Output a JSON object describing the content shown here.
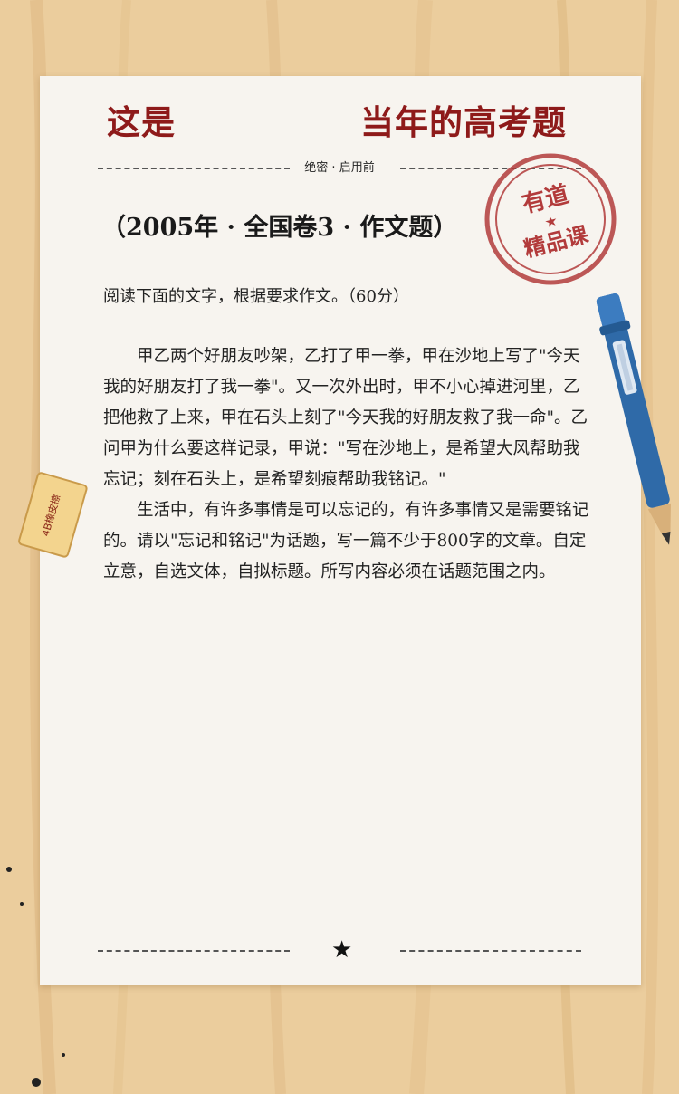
{
  "header": {
    "left": "这是",
    "right": "当年的高考题"
  },
  "secret_label": "绝密 · 启用前",
  "exam_title": "（2005年 · 全国卷3 · 作文题）",
  "prompt": "阅读下面的文字，根据要求作文。（60分）",
  "paragraphs": [
    "甲乙两个好朋友吵架，乙打了甲一拳，甲在沙地上写了\"今天我的好朋友打了我一拳\"。又一次外出时，甲不小心掉进河里，乙把他救了上来，甲在石头上刻了\"今天我的好朋友救了我一命\"。乙问甲为什么要这样记录，甲说：\"写在沙地上，是希望大风帮助我忘记；刻在石头上，是希望刻痕帮助我铭记。\"",
    "生活中，有许多事情是可以忘记的，有许多事情又是需要铭记的。请以\"忘记和铭记\"为话题，写一篇不少于800字的文章。自定立意，自选文体，自拟标题。所写内容必须在话题范围之内。"
  ],
  "stamp": {
    "line1": "有道",
    "star": "★",
    "line2": "精品课"
  },
  "eraser_text": "4B橡皮擦",
  "footer_star": "★",
  "colors": {
    "background": "#eccfa0",
    "paper": "#f7f4ef",
    "heading": "#8e1a1a",
    "stamp": "#b23b3b",
    "pen": "#2f6aa8"
  }
}
